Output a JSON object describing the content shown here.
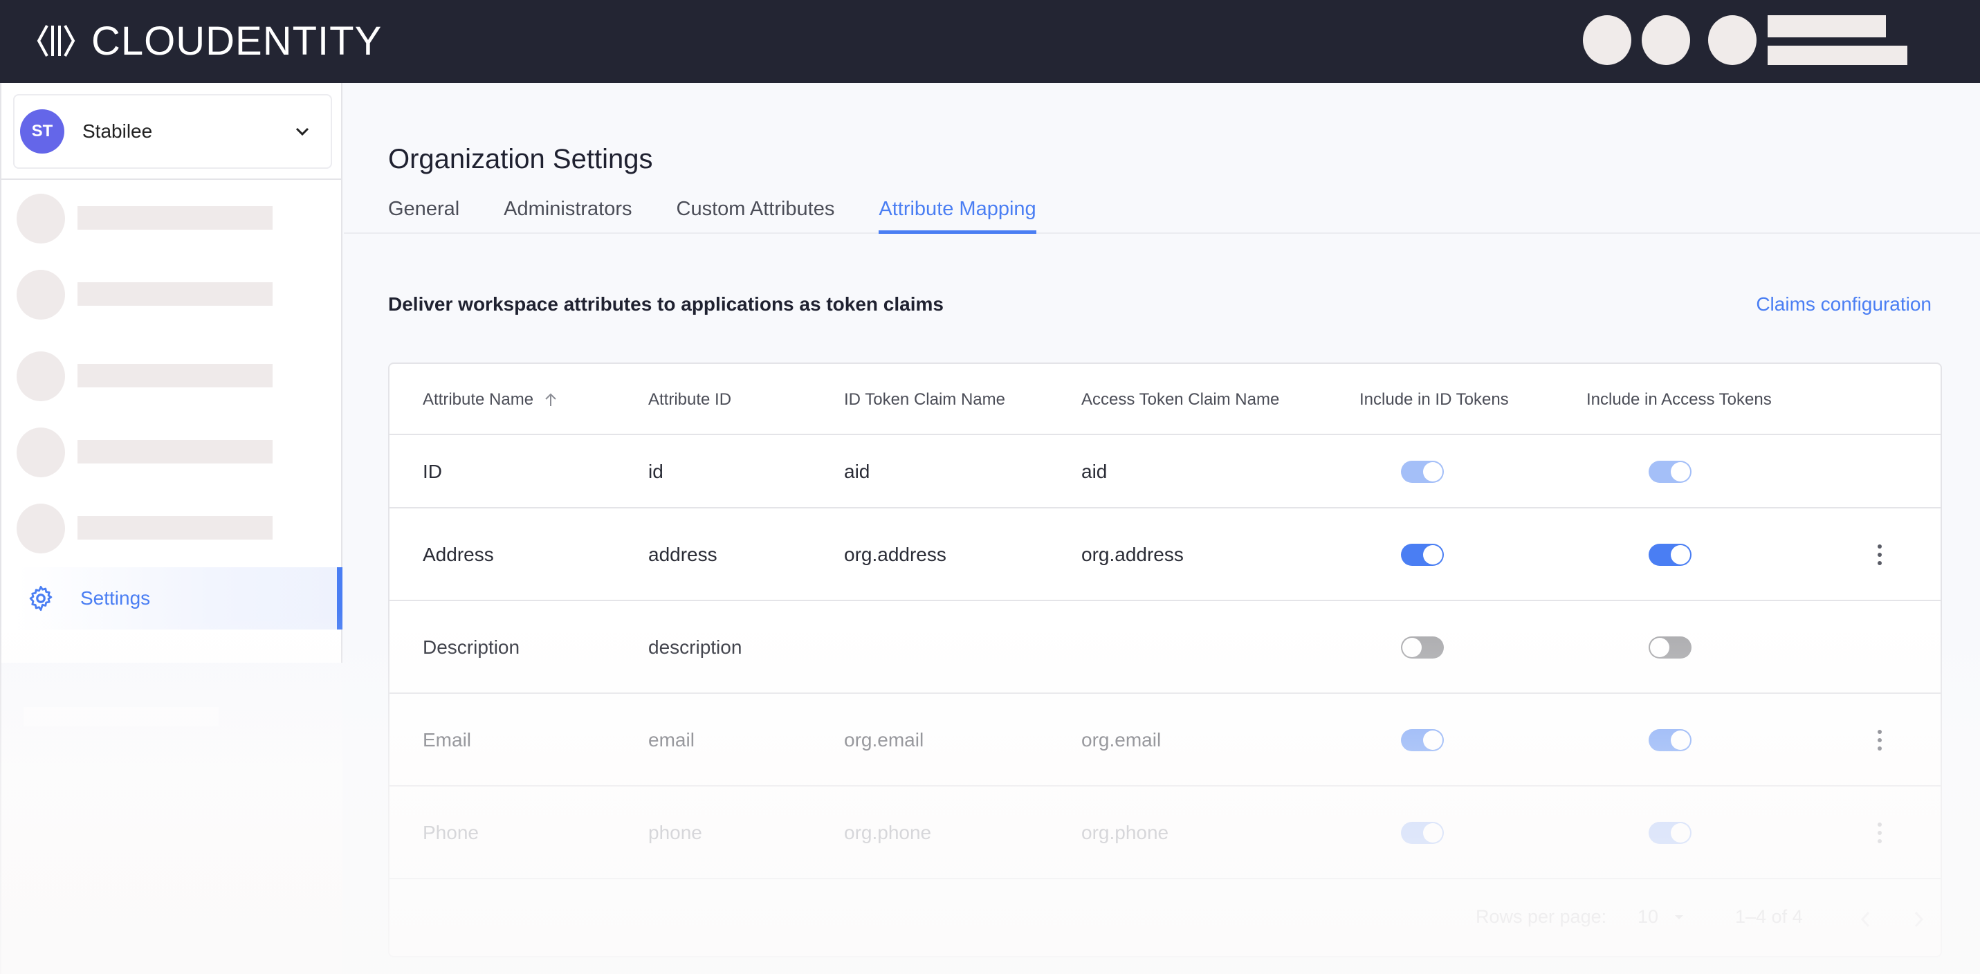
{
  "header": {
    "brand": "CLOUDENTITY",
    "colors": {
      "background": "#232533",
      "placeholder": "#f0ebea"
    }
  },
  "sidebar": {
    "org_switcher": {
      "initials": "ST",
      "name": "Stabilee",
      "avatar_color": "#6466e9"
    },
    "skeleton_items": 5,
    "active_item": {
      "label": "Settings",
      "icon": "gear-icon"
    }
  },
  "page": {
    "title": "Organization Settings",
    "tabs": [
      {
        "label": "General",
        "active": false
      },
      {
        "label": "Administrators",
        "active": false
      },
      {
        "label": "Custom Attributes",
        "active": false
      },
      {
        "label": "Attribute Mapping",
        "active": true
      }
    ],
    "description": "Deliver workspace attributes to applications as token claims",
    "claims_link": "Claims configuration",
    "accent_color": "#4a7ef3"
  },
  "table": {
    "columns": [
      {
        "label": "Attribute Name",
        "sort": "ascending"
      },
      {
        "label": "Attribute ID"
      },
      {
        "label": "ID Token Claim Name"
      },
      {
        "label": "Access Token Claim Name"
      },
      {
        "label": "Include in ID Tokens"
      },
      {
        "label": "Include in Access Tokens"
      }
    ],
    "rows": [
      {
        "name": "ID",
        "id": "id",
        "id_claim": "aid",
        "access_claim": "aid",
        "include_id": true,
        "include_access": true,
        "disabled": true,
        "menu": false
      },
      {
        "name": "Address",
        "id": "address",
        "id_claim": "org.address",
        "access_claim": "org.address",
        "include_id": true,
        "include_access": true,
        "disabled": false,
        "menu": true
      },
      {
        "name": "Description",
        "id": "description",
        "id_claim": "",
        "access_claim": "",
        "include_id": false,
        "include_access": false,
        "disabled": false,
        "menu": false
      },
      {
        "name": "Email",
        "id": "email",
        "id_claim": "org.email",
        "access_claim": "org.email",
        "include_id": true,
        "include_access": true,
        "disabled": false,
        "menu": true
      },
      {
        "name": "Phone",
        "id": "phone",
        "id_claim": "org.phone",
        "access_claim": "org.phone",
        "include_id": true,
        "include_access": true,
        "disabled": false,
        "menu": true
      }
    ],
    "pagination": {
      "rows_per_page_label": "Rows per page:",
      "rows_per_page": "10",
      "range": "1–4 of 4"
    }
  }
}
